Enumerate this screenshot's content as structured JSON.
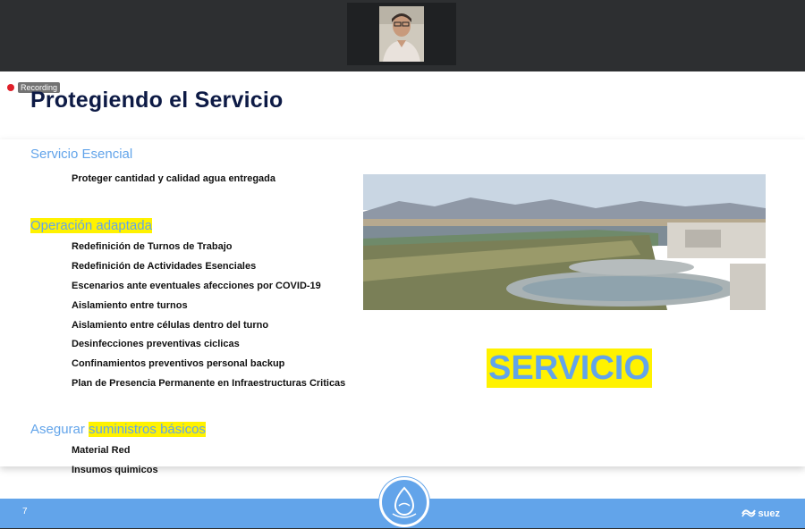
{
  "recording": {
    "label": "Recording"
  },
  "slide": {
    "title": "Protegiendo el Servicio",
    "sections": [
      {
        "heading": "Servicio Esencial",
        "items": [
          "Proteger cantidad y calidad agua entregada"
        ]
      },
      {
        "heading": "Operación adaptada",
        "items": [
          "Redefinición de Turnos de Trabajo",
          "Redefinición de Actividades Esenciales",
          "Escenarios ante eventuales afecciones por COVID-19",
          "Aislamiento entre turnos",
          "Aislamiento entre células dentro del turno",
          "Desinfecciones preventivas ciclicas",
          "Confinamientos preventivos personal backup",
          "Plan de Presencia Permanente en Infraestructuras Criticas"
        ]
      },
      {
        "heading_plain": "Asegurar ",
        "heading_highlight": "suministros básicos",
        "items": [
          "Material Red",
          "Insumos quimicos"
        ]
      }
    ],
    "highlight_word": "SERVICIO",
    "page_number": "7",
    "brand": "suez"
  },
  "colors": {
    "accent_blue": "#62a4ea",
    "highlight_yellow": "#fff200",
    "title_navy": "#0d1a45"
  }
}
